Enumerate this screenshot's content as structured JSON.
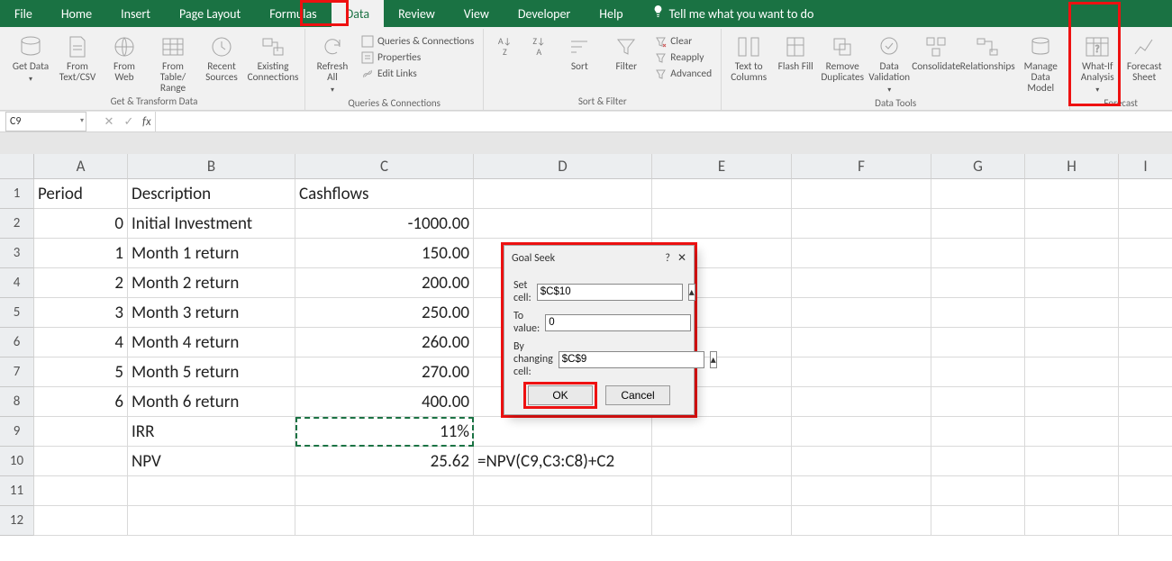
{
  "tabs": {
    "file": "File",
    "home": "Home",
    "insert": "Insert",
    "page_layout": "Page Layout",
    "formulas": "Formulas",
    "data": "Data",
    "review": "Review",
    "view": "View",
    "developer": "Developer",
    "help": "Help",
    "tell_me": "Tell me what you want to do"
  },
  "ribbon": {
    "get_transform": {
      "get_data": "Get Data",
      "from_csv": "From Text/CSV",
      "from_web": "From Web",
      "from_table": "From Table/ Range",
      "recent": "Recent Sources",
      "existing": "Existing Connections",
      "label": "Get & Transform Data"
    },
    "queries": {
      "refresh_all": "Refresh All",
      "queries_conn": "Queries & Connections",
      "properties": "Properties",
      "edit_links": "Edit Links",
      "label": "Queries & Connections"
    },
    "sort_filter": {
      "sort": "Sort",
      "filter": "Filter",
      "clear": "Clear",
      "reapply": "Reapply",
      "advanced": "Advanced",
      "label": "Sort & Filter"
    },
    "data_tools": {
      "text_cols": "Text to Columns",
      "flash_fill": "Flash Fill",
      "remove_dup": "Remove Duplicates",
      "data_val": "Data Validation",
      "consolidate": "Consolidate",
      "relationships": "Relationships",
      "manage_dm": "Manage Data Model",
      "label": "Data Tools"
    },
    "forecast": {
      "whatif": "What-If Analysis",
      "forecast_sheet": "Forecast Sheet",
      "label": "Forecast"
    }
  },
  "name_box": "C9",
  "chart_data": {
    "type": "table",
    "columns": [
      "Period",
      "Description",
      "Cashflows",
      "D"
    ],
    "rows": [
      [
        "0",
        "Initial Investment",
        "-1000.00",
        ""
      ],
      [
        "1",
        "Month 1 return",
        "150.00",
        ""
      ],
      [
        "2",
        "Month 2 return",
        "200.00",
        ""
      ],
      [
        "3",
        "Month 3 return",
        "250.00",
        ""
      ],
      [
        "4",
        "Month 4 return",
        "260.00",
        ""
      ],
      [
        "5",
        "Month 5 return",
        "270.00",
        ""
      ],
      [
        "6",
        "Month 6 return",
        "400.00",
        ""
      ],
      [
        "",
        "IRR",
        "11%",
        ""
      ],
      [
        "",
        "NPV",
        "25.62",
        "=NPV(C9,C3:C8)+C2"
      ]
    ]
  },
  "headers": {
    "A": "Period",
    "B": "Description",
    "C": "Cashflows"
  },
  "cols": {
    "A": "A",
    "B": "B",
    "C": "C",
    "D": "D",
    "E": "E",
    "F": "F",
    "G": "G",
    "H": "H",
    "I": "I"
  },
  "rownums": {
    "r1": "1",
    "r2": "2",
    "r3": "3",
    "r4": "4",
    "r5": "5",
    "r6": "6",
    "r7": "7",
    "r8": "8",
    "r9": "9",
    "r10": "10",
    "r11": "11",
    "r12": "12"
  },
  "rows": {
    "r2": {
      "A": "0",
      "B": "Initial Investment",
      "C": "-1000.00"
    },
    "r3": {
      "A": "1",
      "B": "Month 1 return",
      "C": "150.00"
    },
    "r4": {
      "A": "2",
      "B": "Month 2 return",
      "C": "200.00"
    },
    "r5": {
      "A": "3",
      "B": "Month 3 return",
      "C": "250.00"
    },
    "r6": {
      "A": "4",
      "B": "Month 4 return",
      "C": "260.00"
    },
    "r7": {
      "A": "5",
      "B": "Month 5 return",
      "C": "270.00"
    },
    "r8": {
      "A": "6",
      "B": "Month 6 return",
      "C": "400.00"
    },
    "r9": {
      "B": "IRR",
      "C": "11%"
    },
    "r10": {
      "B": "NPV",
      "C": "25.62",
      "D": "=NPV(C9,C3:C8)+C2"
    }
  },
  "dialog": {
    "title": "Goal Seek",
    "set_cell_label": "Set cell:",
    "set_cell_value": "$C$10",
    "to_value_label": "To value:",
    "to_value_value": "0",
    "by_changing_label": "By changing cell:",
    "by_changing_value": "$C$9",
    "ok": "OK",
    "cancel": "Cancel",
    "help": "?",
    "close": "✕"
  }
}
